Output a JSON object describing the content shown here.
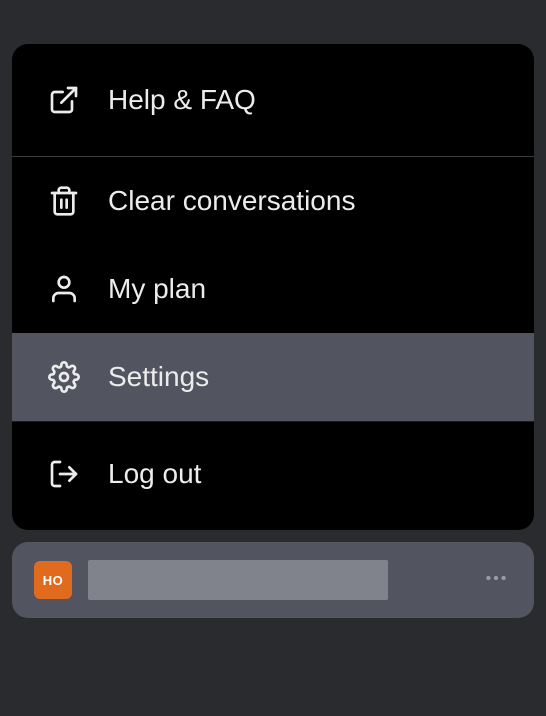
{
  "menu": {
    "help": {
      "label": "Help & FAQ",
      "icon": "external-link-icon"
    },
    "clear": {
      "label": "Clear conversations",
      "icon": "trash-icon"
    },
    "plan": {
      "label": "My plan",
      "icon": "user-icon"
    },
    "settings": {
      "label": "Settings",
      "icon": "gear-icon"
    },
    "logout": {
      "label": "Log out",
      "icon": "logout-icon"
    }
  },
  "account": {
    "avatar_initials": "HO"
  },
  "colors": {
    "background": "#2a2b2e",
    "panel": "#000000",
    "highlight": "#52555f",
    "avatar": "#e06b1f"
  }
}
